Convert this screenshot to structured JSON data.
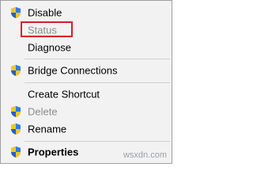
{
  "menu": {
    "items": [
      {
        "label": "Disable",
        "icon": "uac-shield-icon",
        "enabled": true
      },
      {
        "label": "Status",
        "icon": "",
        "enabled": false
      },
      {
        "label": "Diagnose",
        "icon": "",
        "enabled": true
      },
      {
        "label": "Bridge Connections",
        "icon": "uac-shield-icon",
        "enabled": true
      },
      {
        "label": "Create Shortcut",
        "icon": "",
        "enabled": true
      },
      {
        "label": "Delete",
        "icon": "uac-shield-icon",
        "enabled": false
      },
      {
        "label": "Rename",
        "icon": "uac-shield-icon",
        "enabled": true
      },
      {
        "label": "Properties",
        "icon": "uac-shield-icon",
        "enabled": true,
        "bold": true
      }
    ]
  },
  "annotation": {
    "highlight_target": "Status",
    "highlight_color": "#d81b2b"
  },
  "watermark": "wsxdn.com",
  "colors": {
    "menu_bg": "#f2f2f2",
    "disabled_text": "#8c8c8c",
    "separator": "#cfcfcf"
  }
}
